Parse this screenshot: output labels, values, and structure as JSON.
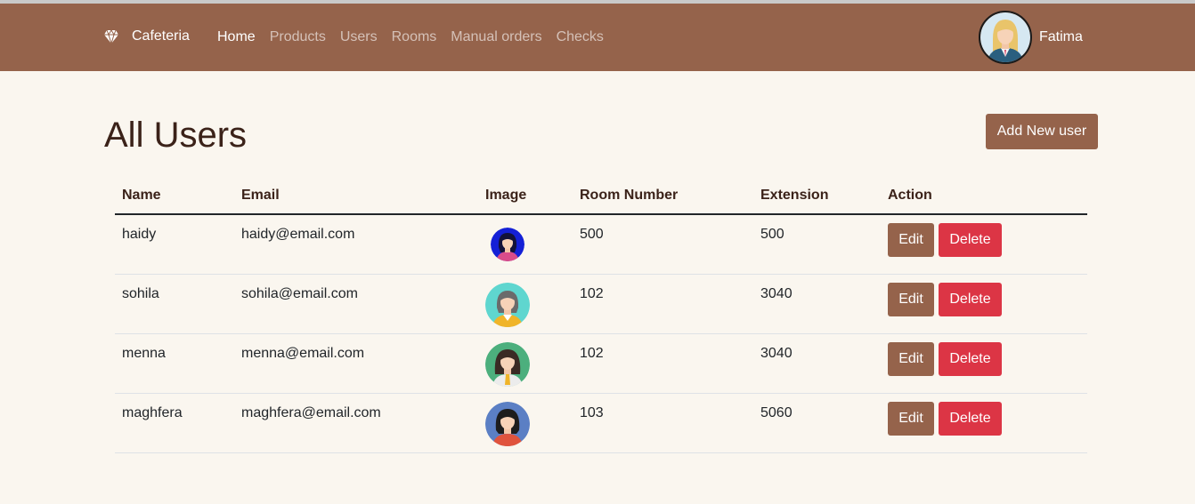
{
  "nav": {
    "brand": "Cafeteria",
    "brand_icon": "diamond-icon",
    "links": [
      "Home",
      "Products",
      "Users",
      "Rooms",
      "Manual orders",
      "Checks"
    ],
    "active": "Home",
    "user_name": "Fatima",
    "bar_color": "#95634b"
  },
  "page": {
    "title": "All Users",
    "add_button": "Add New user"
  },
  "table": {
    "headers": [
      "Name",
      "Email",
      "Image",
      "Room Number",
      "Extension",
      "Action"
    ],
    "rows": [
      {
        "name": "haidy",
        "email": "haidy@email.com",
        "room": "500",
        "ext": "500"
      },
      {
        "name": "sohila",
        "email": "sohila@email.com",
        "room": "102",
        "ext": "3040"
      },
      {
        "name": "menna",
        "email": "menna@email.com",
        "room": "102",
        "ext": "3040"
      },
      {
        "name": "maghfera",
        "email": "maghfera@email.com",
        "room": "103",
        "ext": "5060"
      }
    ],
    "edit_label": "Edit",
    "delete_label": "Delete",
    "delete_color": "#dc3545"
  }
}
